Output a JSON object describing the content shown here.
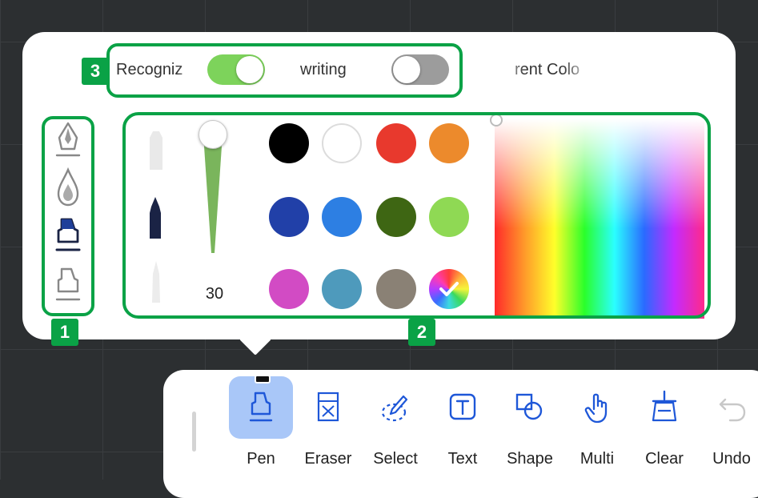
{
  "top_row": {
    "recognize_label": "Recogniz",
    "handwriting_label": "writing",
    "current_color_label": "rent Colo",
    "recognize_on": true,
    "handwriting_on": false
  },
  "pen_types": [
    "fountain-pen",
    "ink-drop",
    "marker-active",
    "highlighter"
  ],
  "pen_size": {
    "value": "30"
  },
  "swatches": [
    "#000000",
    "#ffffff",
    "#e8392d",
    "#ec8a2c",
    "#2140a8",
    "#2d7fe3",
    "#3e6613",
    "#8fd954",
    "#d24bc4",
    "#4e9abc",
    "#8a8175",
    "multicolor"
  ],
  "toolbar": {
    "tools": [
      {
        "label": "Pen"
      },
      {
        "label": "Eraser"
      },
      {
        "label": "Select"
      },
      {
        "label": "Text"
      },
      {
        "label": "Shape"
      },
      {
        "label": "Multi"
      },
      {
        "label": "Clear"
      },
      {
        "label": "Undo"
      }
    ]
  },
  "annotations": {
    "badge1": "1",
    "badge2": "2",
    "badge3": "3"
  },
  "colors": {
    "accent": "#0aa246",
    "active_tool_bg": "#a9c7f8",
    "toggle_on": "#7dd35b",
    "toggle_off": "#9c9c9c",
    "ink": "#1a2345"
  }
}
